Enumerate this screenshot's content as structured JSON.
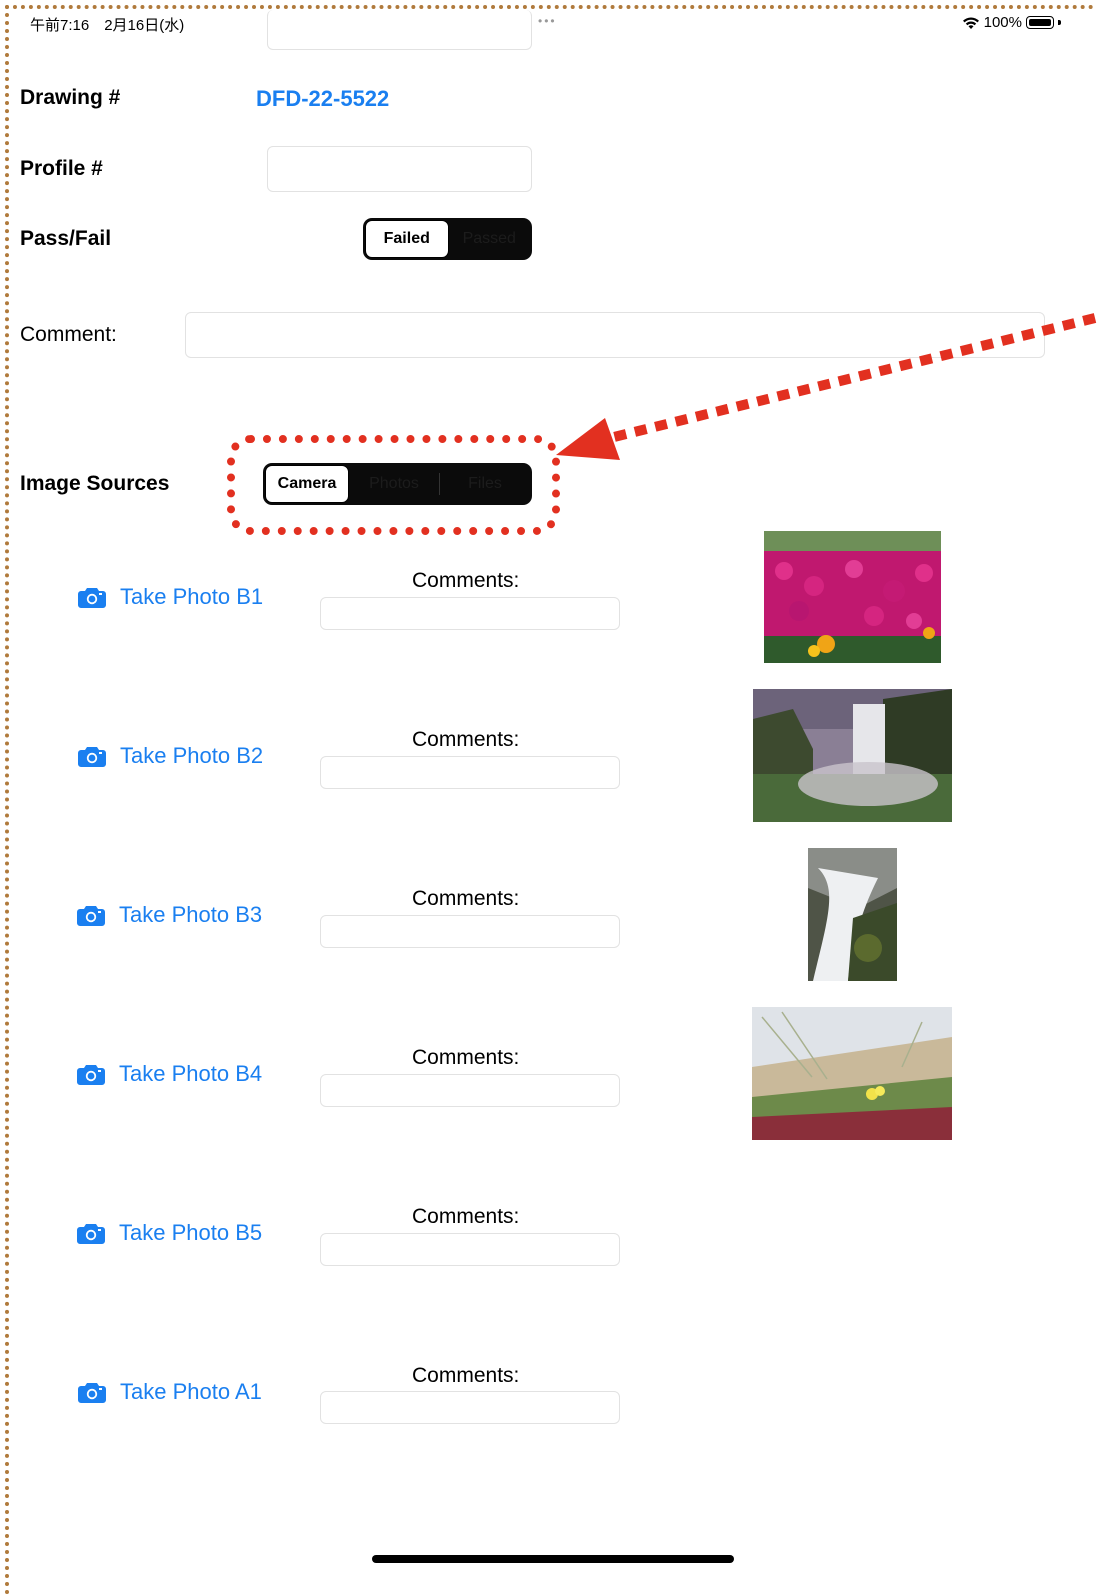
{
  "status_bar": {
    "time_date": "午前7:16　2月16日(水)",
    "dots": "•••",
    "battery_text": "100%"
  },
  "form": {
    "drawing_label": "Drawing #",
    "drawing_value": "DFD-22-5522",
    "profile_label": "Profile #",
    "profile_value": "",
    "passfail_label": "Pass/Fail",
    "passfail_options": [
      "Failed",
      "Passed"
    ],
    "passfail_selected": "Failed",
    "comment_label": "Comment:",
    "comment_value": ""
  },
  "image_sources": {
    "label": "Image Sources",
    "options": [
      "Camera",
      "Photos",
      "Files"
    ],
    "selected": "Camera"
  },
  "photos": [
    {
      "button_label": "Take Photo B1",
      "comments_label": "Comments:",
      "comment": "",
      "thumbnail": "flowers-pink"
    },
    {
      "button_label": "Take Photo B2",
      "comments_label": "Comments:",
      "comment": "",
      "thumbnail": "waterfall-cliff"
    },
    {
      "button_label": "Take Photo B3",
      "comments_label": "Comments:",
      "comment": "",
      "thumbnail": "waterfall-rocks"
    },
    {
      "button_label": "Take Photo B4",
      "comments_label": "Comments:",
      "comment": "",
      "thumbnail": "dune-flower"
    },
    {
      "button_label": "Take Photo B5",
      "comments_label": "Comments:",
      "comment": "",
      "thumbnail": ""
    },
    {
      "button_label": "Take Photo A1",
      "comments_label": "Comments:",
      "comment": "",
      "thumbnail": ""
    }
  ],
  "colors": {
    "accent": "#1a7ff0",
    "annotation": "#e23020",
    "segment_bg": "#0b0b0b"
  }
}
